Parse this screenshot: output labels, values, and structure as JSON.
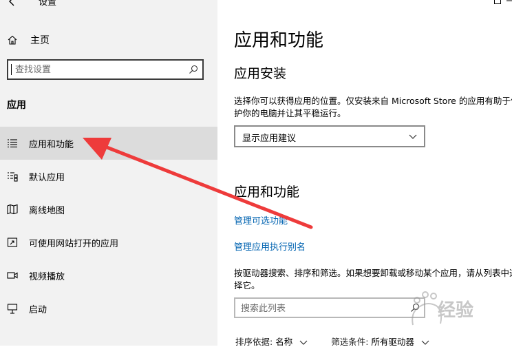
{
  "window": {
    "title": "设置"
  },
  "sidebar": {
    "home_label": "主页",
    "search_placeholder": "查找设置",
    "section_heading": "应用",
    "items": [
      {
        "label": "应用和功能",
        "icon": "list-icon",
        "selected": true
      },
      {
        "label": "默认应用",
        "icon": "default-apps-icon",
        "selected": false
      },
      {
        "label": "离线地图",
        "icon": "map-icon",
        "selected": false
      },
      {
        "label": "可使用网站打开的应用",
        "icon": "website-app-icon",
        "selected": false
      },
      {
        "label": "视频播放",
        "icon": "video-icon",
        "selected": false
      },
      {
        "label": "启动",
        "icon": "startup-icon",
        "selected": false
      }
    ]
  },
  "main": {
    "page_title": "应用和功能",
    "install_heading": "应用安装",
    "install_description": "选择你可以获得应用的位置。仅安装来自 Microsoft Store 的应用有助于保护你的电脑并让其平稳运行。",
    "install_dropdown_value": "显示应用建议",
    "apps_heading": "应用和功能",
    "link_optional_features": "管理可选功能",
    "link_execution_aliases": "管理应用执行别名",
    "apps_description": "按驱动器搜索、排序和筛选。如果想要卸载或移动某个应用，请从列表中选择它。",
    "list_search_placeholder": "搜索此列表",
    "sort_label": "排序依据:",
    "sort_value": "名称",
    "filter_label": "筛选条件:",
    "filter_value": "所有驱动器"
  },
  "watermark": {
    "text": "经验"
  },
  "colors": {
    "link": "#0063b1",
    "arrow": "#ee3b3b",
    "sidebar_bg": "#f2f2f2",
    "selected_bg": "#dcdcdc"
  }
}
